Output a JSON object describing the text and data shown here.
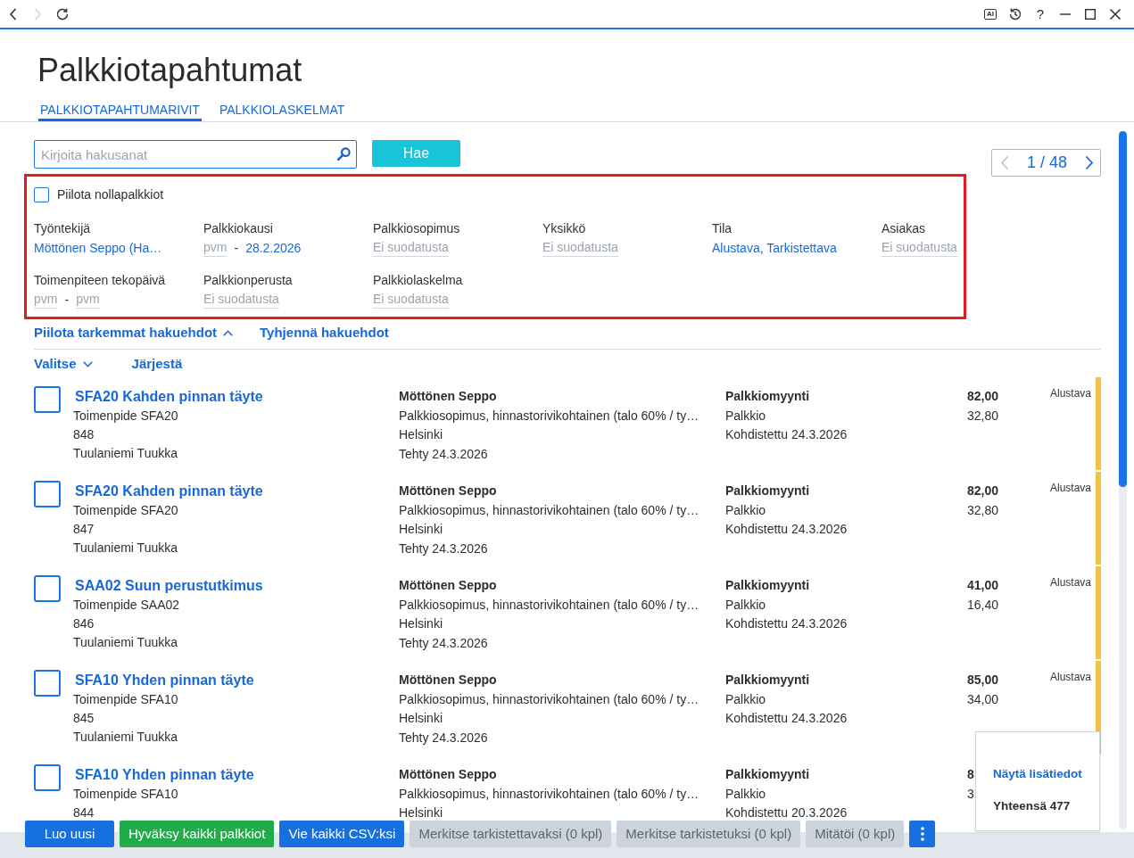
{
  "nav_buttons": [
    {
      "kind": "back",
      "disabled": false
    },
    {
      "kind": "forward",
      "disabled": true
    },
    {
      "kind": "reload",
      "disabled": false
    }
  ],
  "window_buttons": [
    {
      "kind": "ai",
      "label": "AI"
    },
    {
      "kind": "history"
    },
    {
      "kind": "help",
      "label": "?"
    },
    {
      "kind": "minimize"
    },
    {
      "kind": "maximize"
    },
    {
      "kind": "close"
    }
  ],
  "title": "Palkkiotapahtumat",
  "tabs": [
    {
      "label": "PALKKIOTAPAHTUMARIVIT",
      "selected": true
    },
    {
      "label": "PALKKIOLASKELMAT",
      "selected": false
    }
  ],
  "search": {
    "placeholder": "Kirjoita hakusanat",
    "button": "Hae"
  },
  "pager": {
    "text": "1 / 48",
    "prev_disabled": true,
    "next_disabled": false
  },
  "filters": {
    "hide_zero": {
      "label": "Piilota nollapalkkiot",
      "checked": false
    },
    "fields": [
      {
        "label": "Työntekijä",
        "kind": "select",
        "value": "Möttönen Seppo (Ha…"
      },
      {
        "label": "Palkkiokausi",
        "kind": "range",
        "from": {
          "placeholder": "pvm"
        },
        "separator": "-",
        "to": {
          "value": "28.2.2026"
        }
      },
      {
        "label": "Palkkiosopimus",
        "kind": "select",
        "placeholder": "Ei suodatusta"
      },
      {
        "label": "Yksikkö",
        "kind": "select",
        "placeholder": "Ei suodatusta"
      },
      {
        "label": "Tila",
        "kind": "select",
        "value": "Alustava, Tarkistettava"
      },
      {
        "label": "Asiakas",
        "kind": "select",
        "placeholder": "Ei suodatusta"
      },
      {
        "label": "Toimenpiteen tekopäivä",
        "kind": "range",
        "from": {
          "placeholder": "pvm"
        },
        "separator": "-",
        "to": {
          "placeholder": "pvm"
        }
      },
      {
        "label": "Palkkionperusta",
        "kind": "select",
        "placeholder": "Ei suodatusta"
      },
      {
        "label": "Palkkiolaskelma",
        "kind": "select",
        "placeholder": "Ei suodatusta"
      }
    ]
  },
  "links": {
    "toggle": "Piilota tarkemmat hakuehdot",
    "expanded": true,
    "clear": "Tyhjennä hakuehdot"
  },
  "list_toolbar": {
    "select": "Valitse",
    "sort": "Järjestä"
  },
  "rows": [
    {
      "checked": false,
      "title": "SFA20 Kahden pinnan täyte",
      "details": [
        "Toimenpide SFA20",
        "848",
        "Tuulaniemi Tuukka"
      ],
      "party": "Möttönen Seppo",
      "party_details": [
        "Palkkiosopimus, hinnastorivikohtainen (talo 60% / ty…",
        "Helsinki",
        "Tehty 24.3.2026"
      ],
      "type": "Palkkiomyynti",
      "type_details": [
        "Palkkio",
        "Kohdistettu 24.3.2026"
      ],
      "amount": "82,00",
      "amount_2": "32,80",
      "status": "Alustava",
      "color": "#f5c343"
    },
    {
      "checked": false,
      "title": "SFA20 Kahden pinnan täyte",
      "details": [
        "Toimenpide SFA20",
        "847",
        "Tuulaniemi Tuukka"
      ],
      "party": "Möttönen Seppo",
      "party_details": [
        "Palkkiosopimus, hinnastorivikohtainen (talo 60% / ty…",
        "Helsinki",
        "Tehty 24.3.2026"
      ],
      "type": "Palkkiomyynti",
      "type_details": [
        "Palkkio",
        "Kohdistettu 24.3.2026"
      ],
      "amount": "82,00",
      "amount_2": "32,80",
      "status": "Alustava",
      "color": "#f5c343"
    },
    {
      "checked": false,
      "title": "SAA02 Suun perustutkimus",
      "details": [
        "Toimenpide SAA02",
        "846",
        "Tuulaniemi Tuukka"
      ],
      "party": "Möttönen Seppo",
      "party_details": [
        "Palkkiosopimus, hinnastorivikohtainen (talo 60% / ty…",
        "Helsinki",
        "Tehty 24.3.2026"
      ],
      "type": "Palkkiomyynti",
      "type_details": [
        "Palkkio",
        "Kohdistettu 24.3.2026"
      ],
      "amount": "41,00",
      "amount_2": "16,40",
      "status": "Alustava",
      "color": "#f5c343"
    },
    {
      "checked": false,
      "title": "SFA10 Yhden pinnan täyte",
      "details": [
        "Toimenpide SFA10",
        "845",
        "Tuulaniemi Tuukka"
      ],
      "party": "Möttönen Seppo",
      "party_details": [
        "Palkkiosopimus, hinnastorivikohtainen (talo 60% / ty…",
        "Helsinki",
        "Tehty 24.3.2026"
      ],
      "type": "Palkkiomyynti",
      "type_details": [
        "Palkkio",
        "Kohdistettu 24.3.2026"
      ],
      "amount": "85,00",
      "amount_2": "34,00",
      "status": "Alustava",
      "color": "#f5c343"
    },
    {
      "checked": false,
      "title": "SFA10 Yhden pinnan täyte",
      "details": [
        "Toimenpide SFA10",
        "844"
      ],
      "party": "Möttönen Seppo",
      "party_details": [
        "Palkkiosopimus, hinnastorivikohtainen (talo 60% / ty…",
        "Helsinki"
      ],
      "type": "Palkkiomyynti",
      "type_details": [
        "Palkkio",
        "Kohdistettu 20.3.2026"
      ],
      "amount": "8",
      "amount_2": "3"
    }
  ],
  "summary_popup": {
    "link": "Näytä lisätiedot",
    "total": "Yhteensä 477"
  },
  "actions": [
    {
      "label": "Luo uusi",
      "kind": "primary",
      "disabled": false
    },
    {
      "label": "Hyväksy kaikki palkkiot",
      "kind": "success",
      "disabled": false
    },
    {
      "label": "Vie kaikki CSV:ksi",
      "kind": "primary",
      "disabled": false
    },
    {
      "label": "Merkitse tarkistettavaksi (0 kpl)",
      "kind": "primary",
      "disabled": true
    },
    {
      "label": "Merkitse tarkistetuksi (0 kpl)",
      "kind": "primary",
      "disabled": true
    },
    {
      "label": "Mitätöi (0 kpl)",
      "kind": "primary",
      "disabled": true
    },
    {
      "kind": "more",
      "disabled": false
    }
  ]
}
